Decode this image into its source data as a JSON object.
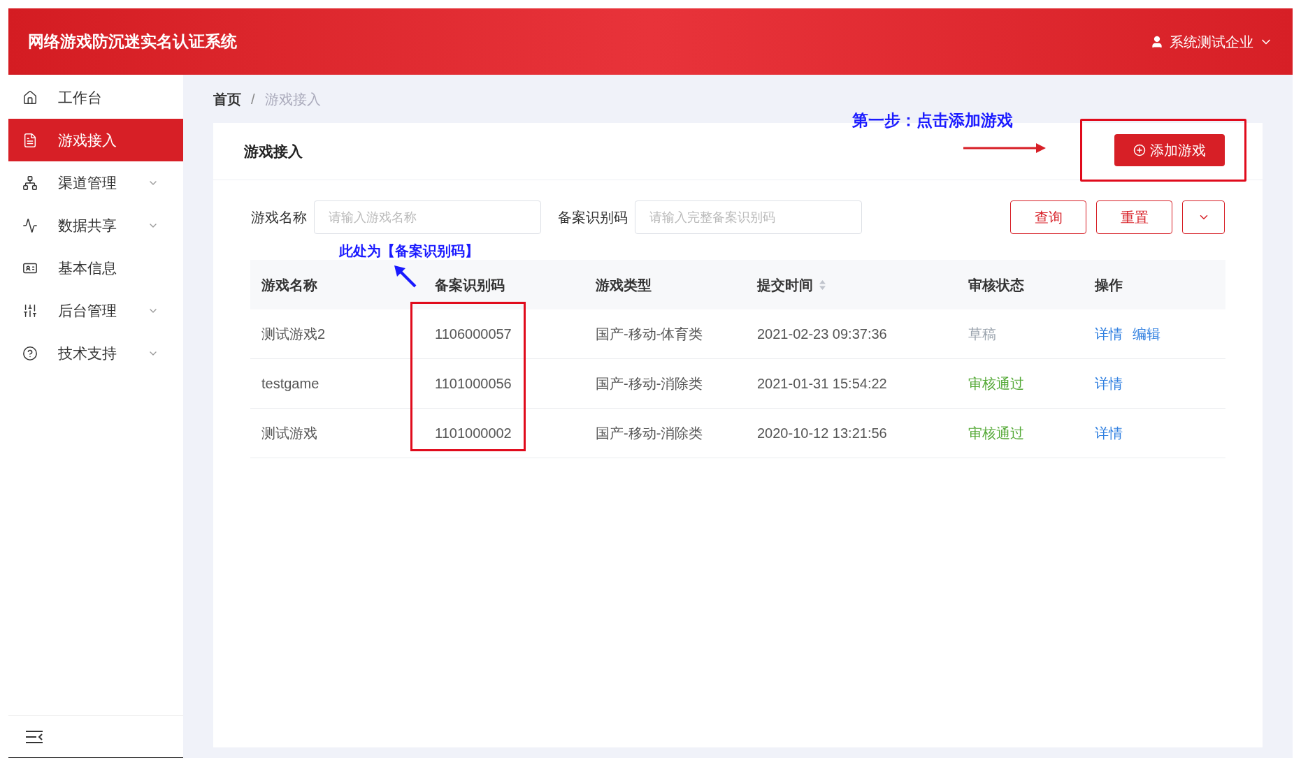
{
  "header": {
    "title": "网络游戏防沉迷实名认证系统",
    "user": "系统测试企业"
  },
  "sidebar": {
    "items": [
      {
        "label": "工作台",
        "selected": false,
        "expandable": false
      },
      {
        "label": "游戏接入",
        "selected": true,
        "expandable": false
      },
      {
        "label": "渠道管理",
        "selected": false,
        "expandable": true
      },
      {
        "label": "数据共享",
        "selected": false,
        "expandable": true
      },
      {
        "label": "基本信息",
        "selected": false,
        "expandable": false
      },
      {
        "label": "后台管理",
        "selected": false,
        "expandable": true
      },
      {
        "label": "技术支持",
        "selected": false,
        "expandable": true
      }
    ]
  },
  "breadcrumb": [
    "首页",
    "游戏接入"
  ],
  "breadcrumb_separator": "/",
  "card": {
    "title": "游戏接入",
    "add_button": "添加游戏"
  },
  "filters": [
    {
      "label": "游戏名称",
      "placeholder": "请输入游戏名称"
    },
    {
      "label": "备案识别码",
      "placeholder": "请输入完整备案识别码"
    }
  ],
  "filter_buttons": {
    "query": "查询",
    "reset": "重置"
  },
  "table": {
    "columns": [
      {
        "label": "游戏名称",
        "sortable": false
      },
      {
        "label": "备案识别码",
        "sortable": false
      },
      {
        "label": "游戏类型",
        "sortable": false
      },
      {
        "label": "提交时间",
        "sortable": true
      },
      {
        "label": "审核状态",
        "sortable": false
      },
      {
        "label": "操作",
        "sortable": false
      }
    ],
    "rows": [
      {
        "name": "测试游戏2",
        "code": "1106000057",
        "type": "国产-移动-体育类",
        "time": "2021-02-23 09:37:36",
        "status": {
          "text": "草稿",
          "color": "#9aa3ad"
        },
        "actions": [
          "详情",
          "编辑"
        ]
      },
      {
        "name": "testgame",
        "code": "1101000056",
        "type": "国产-移动-消除类",
        "time": "2021-01-31 15:54:22",
        "status": {
          "text": "审核通过",
          "color": "#52a834"
        },
        "actions": [
          "详情"
        ]
      },
      {
        "name": "测试游戏",
        "code": "1101000002",
        "type": "国产-移动-消除类",
        "time": "2020-10-12 13:21:56",
        "status": {
          "text": "审核通过",
          "color": "#52a834"
        },
        "actions": [
          "详情"
        ]
      }
    ]
  },
  "annotations": {
    "step_note": "第一步：点击添加游戏",
    "code_note": "此处为【备案识别码】"
  }
}
